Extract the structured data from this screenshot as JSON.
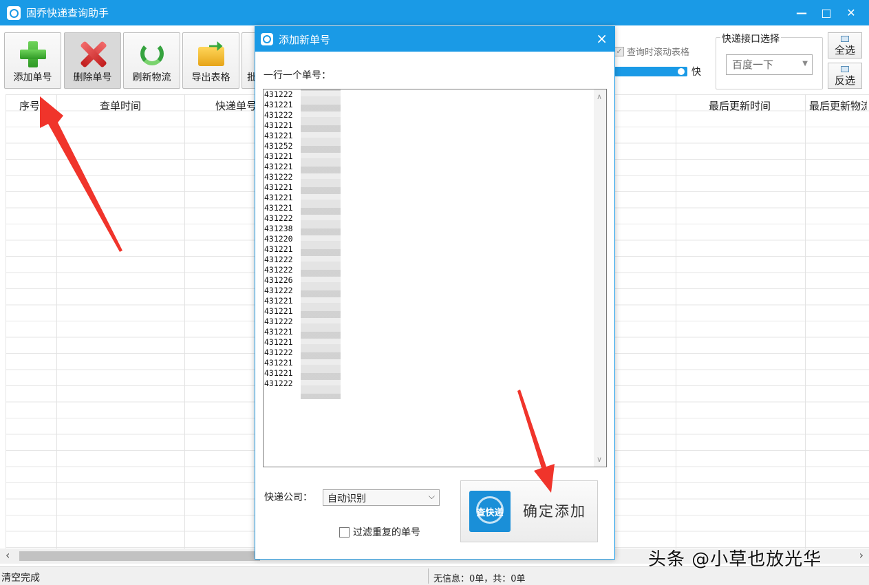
{
  "window": {
    "title": "固乔快递查询助手",
    "controls": [
      "—",
      "□",
      "✕"
    ]
  },
  "toolbar": {
    "add": "添加单号",
    "delete": "删除单号",
    "refresh": "刷新物流",
    "export": "导出表格",
    "partial": "批",
    "scroll_option": "查询时滚动表格",
    "speed_label": "快",
    "api_group_label": "快递接口选择",
    "api_selected": "百度一下",
    "select_all": "全选",
    "invert": "反选"
  },
  "table": {
    "headers": [
      "序号",
      "查单时间",
      "快递单号",
      "最后更新时间",
      "最后更新物流"
    ]
  },
  "status": {
    "left": "清空完成",
    "right": "无信息：0单，共：0单"
  },
  "watermark": "头条 @小草也放光华",
  "dialog": {
    "title": "添加新单号",
    "close": "×",
    "hint": "一行一个单号：",
    "numbers": [
      "431222",
      "431221",
      "431222",
      "431221",
      "431221",
      "431252",
      "431221",
      "431221",
      "431222",
      "431221",
      "431221",
      "431221",
      "431222",
      "431238",
      "431220",
      "431221",
      "431222",
      "431222",
      "431226",
      "431222",
      "431221",
      "431221",
      "431222",
      "431221",
      "431221",
      "431222",
      "431221",
      "431221",
      "431222"
    ],
    "company_label": "快递公司：",
    "company_value": "自动识别",
    "filter_label": "过滤重复的单号",
    "confirm_icon_text": "查快递",
    "confirm_label": "确定添加"
  }
}
